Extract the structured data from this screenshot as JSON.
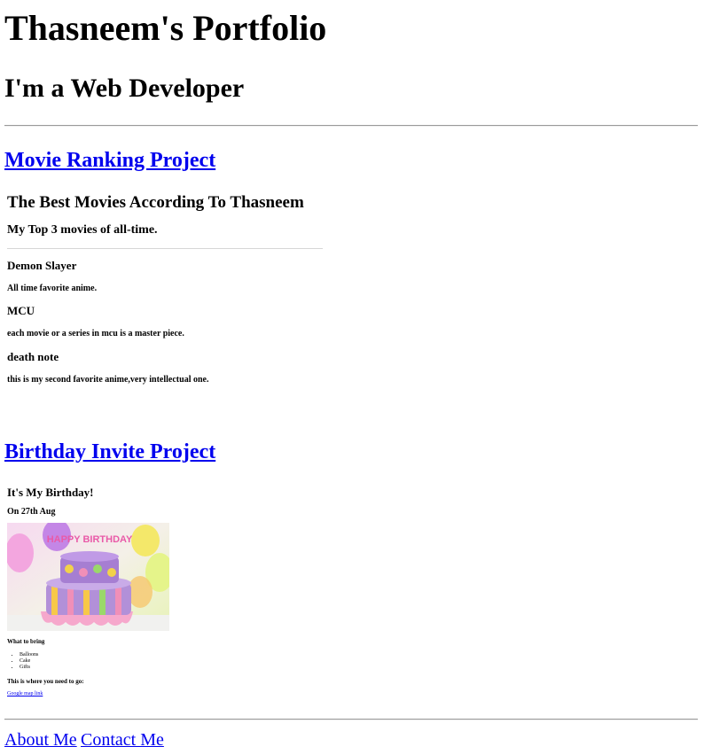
{
  "header": {
    "title": "Thasneem's Portfolio",
    "subtitle": "I'm a Web Developer"
  },
  "projects": [
    {
      "link_label": "Movie Ranking Project",
      "embed": {
        "heading": "The Best Movies According To Thasneem",
        "subheading": "My Top 3 movies of all-time.",
        "movies": [
          {
            "title": "Demon Slayer",
            "description": "All time favorite anime."
          },
          {
            "title": "MCU",
            "description": "each movie or a series in mcu is a master piece."
          },
          {
            "title": "death note",
            "description": "this is my second favorite anime,very intellectual one."
          }
        ]
      }
    },
    {
      "link_label": "Birthday Invite Project",
      "embed": {
        "heading": "It's My Birthday!",
        "date_line": "On 27th Aug",
        "image_alt": "birthday-cake",
        "cake_text": "HAPPY BIRTHDAY",
        "bring_heading": "What to bring",
        "bring_items": [
          "Balloons",
          "Cake",
          "Gifts"
        ],
        "location_heading": "This is where you need to go:",
        "map_link": "Google map link"
      }
    }
  ],
  "footer": {
    "about_label": "About Me",
    "contact_label": "Contact Me"
  },
  "colors": {
    "link": "#0000ee",
    "rule": "#9a9a9a"
  }
}
